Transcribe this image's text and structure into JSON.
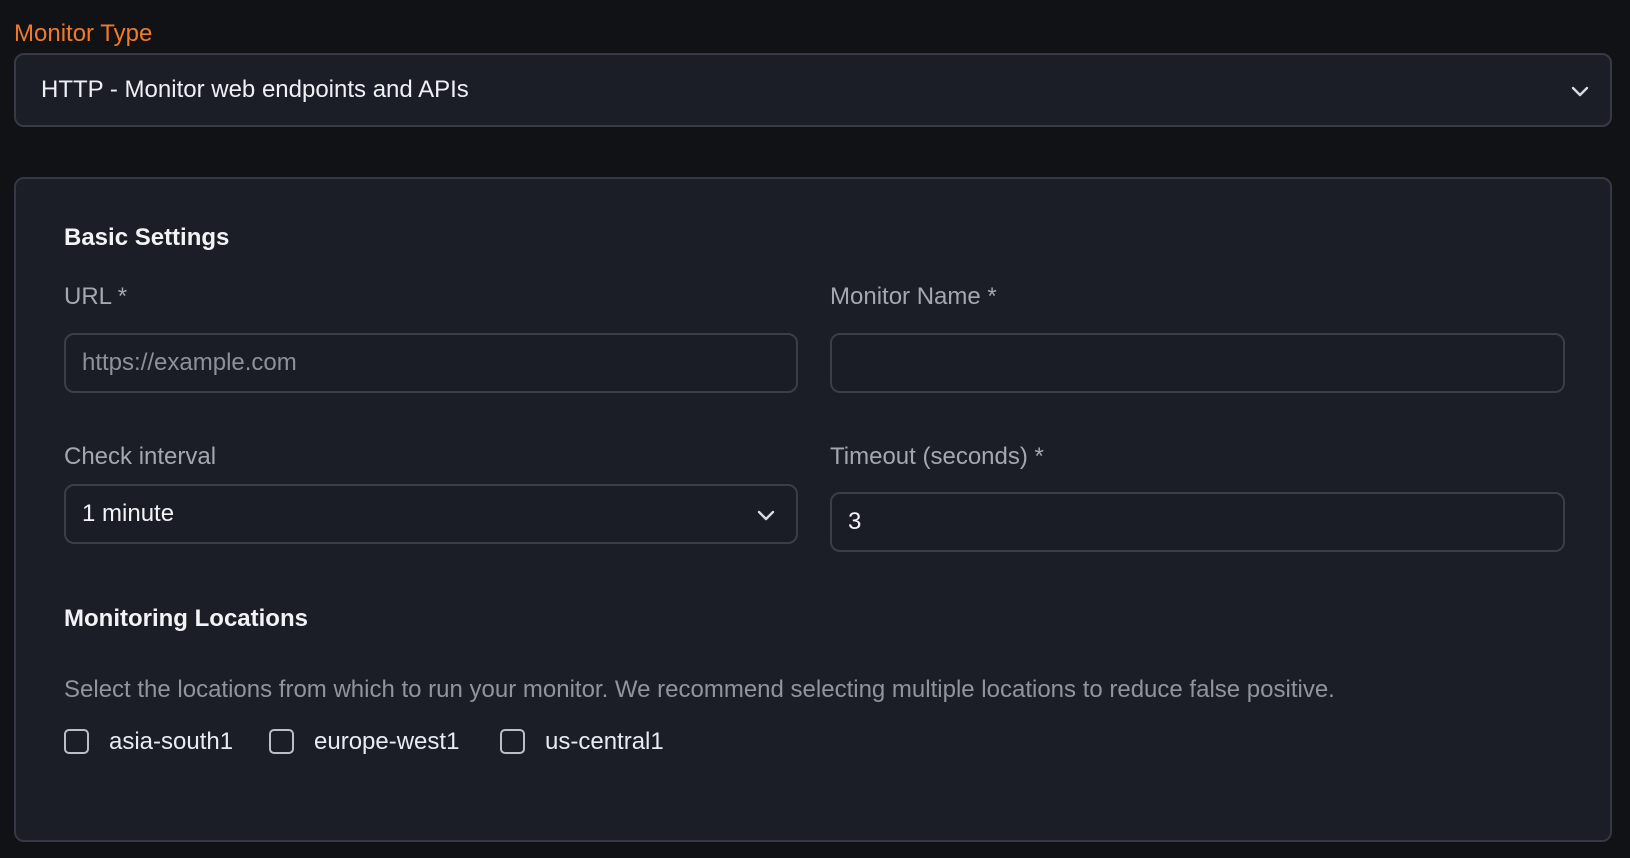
{
  "monitor_type": {
    "label": "Monitor Type",
    "selected_value": "HTTP - Monitor web endpoints and APIs",
    "chevron_icon": "chevron-down-icon"
  },
  "basic_settings": {
    "title": "Basic Settings",
    "url": {
      "label": "URL *",
      "placeholder": "https://example.com",
      "value": ""
    },
    "monitor_name": {
      "label": "Monitor Name *",
      "placeholder": "",
      "value": ""
    },
    "check_interval": {
      "label": "Check interval",
      "selected_value": "1 minute",
      "chevron_icon": "chevron-down-icon"
    },
    "timeout": {
      "label": "Timeout (seconds) *",
      "value": "3"
    }
  },
  "monitoring_locations": {
    "title": "Monitoring Locations",
    "description": "Select the locations from which to run your monitor. We recommend selecting multiple locations to reduce false positive.",
    "options": [
      {
        "label": "asia-south1",
        "checked": false
      },
      {
        "label": "europe-west1",
        "checked": false
      },
      {
        "label": "us-central1",
        "checked": false
      }
    ]
  },
  "colors": {
    "page_background": "#111216",
    "card_background": "#1b1e26",
    "border": "#363a45",
    "accent_label": "#f07a2a",
    "primary_text": "#f1f3f6",
    "secondary_text": "#a2a7b2"
  }
}
